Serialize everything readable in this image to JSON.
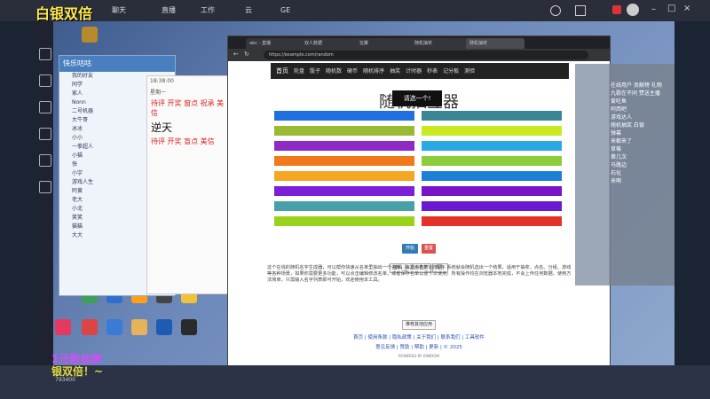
{
  "overlay": {
    "title": "白银双倍",
    "bottom_line1": "1元粉丝牌",
    "bottom_line2": "银双倍！~",
    "bottom_stat": "793400"
  },
  "topbar": {
    "tabs": [
      "聊天",
      "直播",
      "工作",
      "云",
      "GE"
    ]
  },
  "qq": {
    "title": "快乐咕咕",
    "rows": [
      "我的好友",
      "同学",
      "家人",
      "Nonn",
      "二号机器",
      "大牛哥",
      "冰冰",
      "小小",
      "一拳超人",
      "小猫",
      "快",
      "小宇",
      "游戏人生",
      "阿黄",
      "老大",
      "小北",
      "笑笑",
      "猫猫",
      "大大"
    ]
  },
  "chat": {
    "messages": [
      "18:38:00",
      "星期一"
    ],
    "big_text": "逆天",
    "red_lines": [
      "待评 开奖 窗点 祝承 美信",
      "待评 开奖 盲点 美信"
    ]
  },
  "browser": {
    "tabs": [
      "abc - 直播",
      "双人数据",
      "在聚",
      "随机抽奖",
      "随机抽奖"
    ],
    "url": "https://example.com/random",
    "nav": [
      "首页",
      "轮盘",
      "骰子",
      "随机数",
      "硬币",
      "随机排序",
      "抽奖",
      "计时器",
      "秒表",
      "记分板",
      "测验"
    ],
    "page_title": "随机抽签器",
    "popup": "请选一个!",
    "bars_left": [
      "#1f6fe0",
      "#9aba33",
      "#8e2bc4",
      "#f07a1a",
      "#f5a623",
      "#7b1fd8",
      "#46a0a8",
      "#9ad11a"
    ],
    "bars_right": [
      "#3b8696",
      "#c9ea20",
      "#2aa9e4",
      "#8ccd3a",
      "#1d7fd8",
      "#7a12c7",
      "#6a1bd0",
      "#e53228"
    ],
    "start_label": "开始",
    "reset_label": "重置",
    "opt_buttons": [
      "编辑",
      "显示名单",
      "保存"
    ],
    "paragraph": "这个在线的随机名字生成器，可以帮你快速从名单里抽出一个名字，每次点击开始按钮，系统就会随机选出一个结果，适用于抽奖、点名、分组、游戏等各种场景，如果你需要更多功能，可以点击编辑修改名单，或者保存名单以便下次使用，所有操作均在浏览器本地完成，不会上传任何数据，使用方法简单，只需输入名字列表即可开始，欢迎使用本工具。",
    "small_button": "推荐其他应用",
    "links1": "首页 | 使用条款 | 隐私政策 | 关于我们 | 联系我们 | 工具软件",
    "links2": "意见反馈 | 赞助 | 帮助 | 更新 | © 2025",
    "powered": "POWERED BY RANDOM"
  },
  "rightpanel": {
    "header": [
      "在线用户",
      "贡献榜",
      "礼物"
    ],
    "lines": [
      "九歌在不同 赞送主播",
      "爱吃鱼",
      "阿西吧",
      "游戏达人",
      "随机抽奖 白银",
      "弹幕",
      "来都来了",
      "草莓",
      "第几次",
      "马路边",
      "石化",
      "来啊"
    ]
  },
  "colors": {
    "start": "#337ab7",
    "reset": "#d9534f"
  }
}
